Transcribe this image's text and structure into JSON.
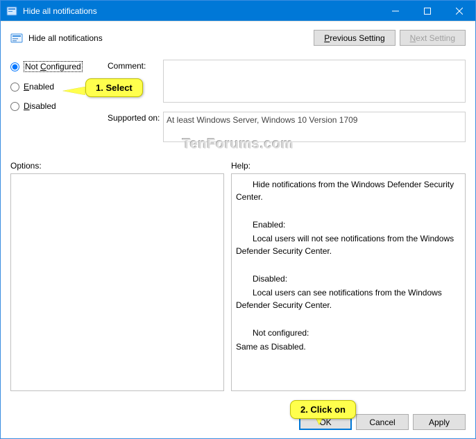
{
  "window": {
    "title": "Hide all notifications"
  },
  "header": {
    "title": "Hide all notifications",
    "prev_label": "Previous Setting",
    "next_label": "Next Setting"
  },
  "radios": {
    "not_configured": "Not Configured",
    "enabled": "Enabled",
    "disabled": "Disabled",
    "selected": "not_configured"
  },
  "fields": {
    "comment_label": "Comment:",
    "comment_value": "",
    "supported_label": "Supported on:",
    "supported_value": "At least Windows Server, Windows 10 Version 1709"
  },
  "mid": {
    "options_label": "Options:",
    "help_label": "Help:"
  },
  "help": {
    "p1": "Hide notifications from the Windows Defender Security Center.",
    "p2": "Enabled:",
    "p3": "Local users will not see notifications from the Windows Defender Security Center.",
    "p4": "Disabled:",
    "p5": "Local users can see notifications from the Windows Defender Security Center.",
    "p6": "Not configured:",
    "p7": "Same as Disabled."
  },
  "footer": {
    "ok": "OK",
    "cancel": "Cancel",
    "apply": "Apply"
  },
  "callouts": {
    "c1": "1. Select",
    "c2": "2. Click on"
  },
  "watermark": "TenForums.com"
}
